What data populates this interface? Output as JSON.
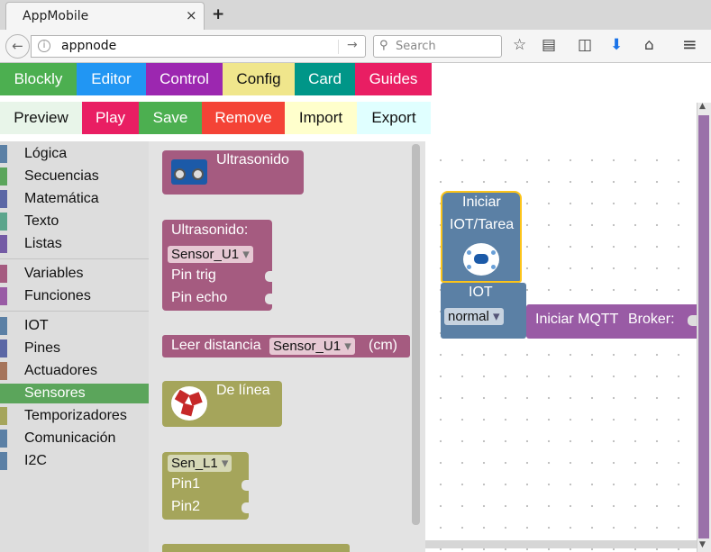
{
  "browser": {
    "tab_title": "AppMobile",
    "tab_close": "×",
    "new_tab": "+",
    "url": "appnode",
    "search_placeholder": "Search",
    "back_glyph": "←",
    "go_glyph": "→",
    "info_glyph": "i",
    "search_glyph": "⚲",
    "toolbar_icons": {
      "bookmark_star": "☆",
      "reading_list": "▤",
      "pocket": "◫",
      "downloads": "⬇",
      "home": "⌂",
      "menu": "≡"
    }
  },
  "app_menu": {
    "top": [
      {
        "label": "Blockly",
        "color": "#4caf50"
      },
      {
        "label": "Editor",
        "color": "#2196f3"
      },
      {
        "label": "Control",
        "color": "#9c27b0"
      },
      {
        "label": "Config",
        "color": "#f0e68c"
      },
      {
        "label": "Card",
        "color": "#009688"
      },
      {
        "label": "Guides",
        "color": "#e91e63"
      }
    ],
    "bottom": [
      {
        "label": "Preview",
        "color": "#e8f5e9"
      },
      {
        "label": "Play",
        "color": "#e91e63"
      },
      {
        "label": "Save",
        "color": "#4caf50"
      },
      {
        "label": "Remove",
        "color": "#f44336"
      },
      {
        "label": "Import",
        "color": "#ffffcc"
      },
      {
        "label": "Export",
        "color": "#e0ffff"
      }
    ]
  },
  "toolbox": {
    "categories": [
      {
        "label": "Lógica",
        "color": "#5b80a5"
      },
      {
        "label": "Secuencias",
        "color": "#5ba55b"
      },
      {
        "label": "Matemática",
        "color": "#5b67a5"
      },
      {
        "label": "Texto",
        "color": "#5ba58c"
      },
      {
        "label": "Listas",
        "color": "#745ba5"
      },
      {
        "label": "Variables",
        "color": "#a55b80"
      },
      {
        "label": "Funciones",
        "color": "#995ba5"
      },
      {
        "label": "IOT",
        "color": "#5b80a5"
      },
      {
        "label": "Pines",
        "color": "#5b67a5"
      },
      {
        "label": "Actuadores",
        "color": "#a5745b"
      },
      {
        "label": "Sensores",
        "color": "#5ba55b"
      },
      {
        "label": "Temporizadores",
        "color": "#a5a55b"
      },
      {
        "label": "Comunicación",
        "color": "#5b80a5"
      },
      {
        "label": "I2C",
        "color": "#5b80a5"
      }
    ],
    "selected": "Sensores"
  },
  "flyout": {
    "ultrasonido_title": "Ultrasonido",
    "ultrasonido_setup": "Ultrasonido:",
    "sensor_u1": "Sensor_U1",
    "pin_trig": "Pin trig",
    "pin_echo": "Pin echo",
    "leer_distancia": "Leer distancia",
    "cm": "(cm)",
    "de_linea": "De línea",
    "sen_l1": "Sen_L1",
    "pin1": "Pin1",
    "pin2": "Pin2",
    "dropdown_arrow": "▾"
  },
  "workspace": {
    "iniciar_line1": "Iniciar",
    "iniciar_line2": "IOT/Tarea",
    "iot_label": "IOT",
    "iot_mode": "normal",
    "mqtt_label": "Iniciar MQTT",
    "broker_label": "Broker:"
  }
}
